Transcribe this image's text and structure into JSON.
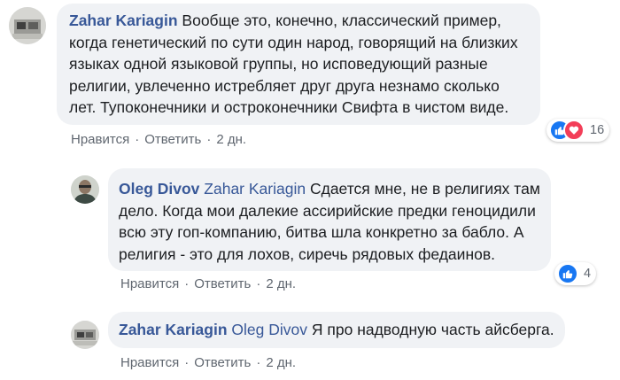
{
  "comments": [
    {
      "author": "Zahar Kariagin",
      "mention": "",
      "text": "Вообще это, конечно, классический пример, когда генетический по сути один народ, говорящий на близких языках одной языковой группы, но исповедующий разные религии, увлеченно истребляет друг друга незнамо сколько лет. Тупоконечники и остроконечники Свифта в чистом виде.",
      "actions": {
        "like": "Нравится",
        "reply": "Ответить",
        "time": "2 дн."
      },
      "reactions": {
        "count": "16",
        "icons": [
          "like-icon",
          "love-icon"
        ]
      }
    },
    {
      "author": "Oleg Divov",
      "mention": "Zahar Kariagin",
      "text": "Сдается мне, не в религиях там дело. Когда мои далекие ассирийские предки геноцидили всю эту гоп-компанию, битва шла конкретно за бабло. А религия - это для лохов, сиречь рядовых федаинов.",
      "actions": {
        "like": "Нравится",
        "reply": "Ответить",
        "time": "2 дн."
      },
      "reactions": {
        "count": "4",
        "icons": [
          "like-icon"
        ]
      }
    },
    {
      "author": "Zahar Kariagin",
      "mention": "Oleg Divov",
      "text": "Я про надводную часть айсберга.",
      "actions": {
        "like": "Нравится",
        "reply": "Ответить",
        "time": "2 дн."
      }
    }
  ],
  "separator": "·",
  "colors": {
    "author": "#385898",
    "bubble": "#f0f2f5",
    "like": "#1877f2",
    "love": "#f33e58",
    "meta": "#606770"
  }
}
